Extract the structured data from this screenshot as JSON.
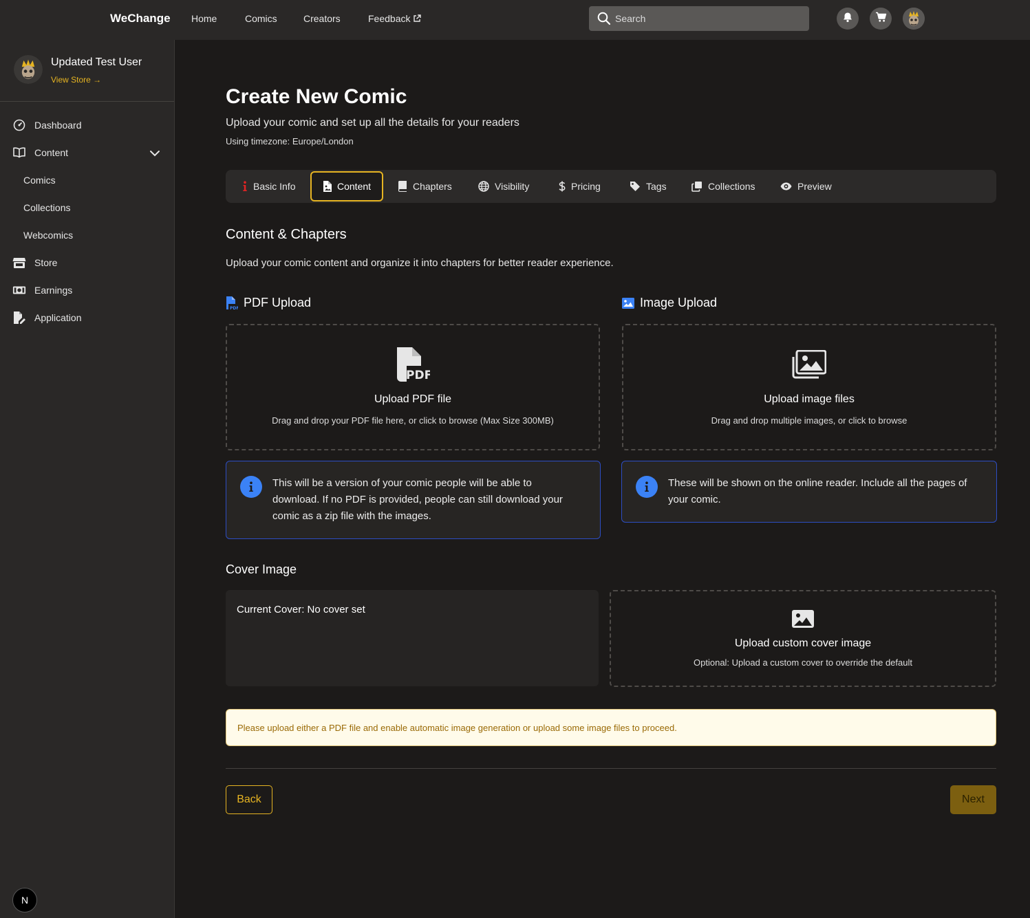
{
  "app": {
    "brand": "WeChange",
    "nav": [
      "Home",
      "Comics",
      "Creators",
      "Feedback"
    ],
    "search_placeholder": "Search",
    "accent": "#e6b422",
    "info_accent": "#3b82f6"
  },
  "sidebar": {
    "user_name": "Updated Test User",
    "view_store": "View Store →",
    "items": [
      {
        "label": "Dashboard",
        "icon": "gauge-icon"
      },
      {
        "label": "Content",
        "icon": "book-open-icon"
      },
      {
        "label": "Comics"
      },
      {
        "label": "Collections"
      },
      {
        "label": "Webcomics"
      },
      {
        "label": "Store",
        "icon": "store-icon"
      },
      {
        "label": "Earnings",
        "icon": "money-bill-icon"
      },
      {
        "label": "Application",
        "icon": "file-pen-icon"
      }
    ],
    "badge": "N"
  },
  "page": {
    "title": "Create New Comic",
    "subtitle": "Upload your comic and set up all the details for your readers",
    "timezone": "Using timezone: Europe/London"
  },
  "tabs": [
    {
      "label": "Basic Info",
      "icon": "info-icon"
    },
    {
      "label": "Content",
      "icon": "file-image-icon",
      "active": true
    },
    {
      "label": "Chapters",
      "icon": "book-icon"
    },
    {
      "label": "Visibility",
      "icon": "globe-icon"
    },
    {
      "label": "Pricing",
      "icon": "dollar-icon"
    },
    {
      "label": "Tags",
      "icon": "tag-icon"
    },
    {
      "label": "Collections",
      "icon": "clone-icon"
    },
    {
      "label": "Preview",
      "icon": "eye-icon"
    }
  ],
  "content": {
    "title": "Content & Chapters",
    "desc": "Upload your comic content and organize it into chapters for better reader experience.",
    "pdf": {
      "heading": "PDF Upload",
      "drop_title": "Upload PDF file",
      "drop_desc": "Drag and drop your PDF file here, or click to browse (Max Size 300MB)",
      "info": "This will be a version of your comic people will be able to download. If no PDF is provided, people can still download your comic as a zip file with the images."
    },
    "images": {
      "heading": "Image Upload",
      "drop_title": "Upload image files",
      "drop_desc": "Drag and drop multiple images, or click to browse",
      "info": "These will be shown on the online reader. Include all the pages of your comic."
    }
  },
  "cover": {
    "title": "Cover Image",
    "current": "Current Cover: No cover set",
    "upload_title": "Upload custom cover image",
    "upload_desc": "Optional: Upload a custom cover to override the default"
  },
  "warning": "Please upload either a PDF file and enable automatic image generation or upload some image files to proceed.",
  "footer": {
    "back": "Back",
    "next": "Next"
  }
}
